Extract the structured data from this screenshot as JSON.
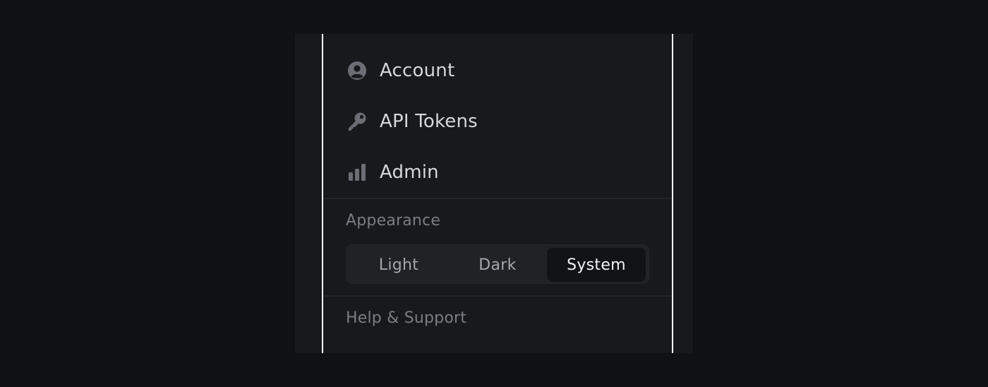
{
  "menu": {
    "items": [
      {
        "label": "Account",
        "icon": "account-circle-icon"
      },
      {
        "label": "API Tokens",
        "icon": "key-icon"
      },
      {
        "label": "Admin",
        "icon": "bar-chart-icon"
      }
    ]
  },
  "appearance": {
    "title": "Appearance",
    "options": [
      "Light",
      "Dark",
      "System"
    ],
    "selected": "System"
  },
  "help": {
    "label": "Help & Support"
  },
  "colors": {
    "background": "#0f1115",
    "panel": "#18191c",
    "icon": "#6b6e75",
    "text": "#d6d7da",
    "muted": "#7a7d84",
    "active_segment": "#121316"
  }
}
